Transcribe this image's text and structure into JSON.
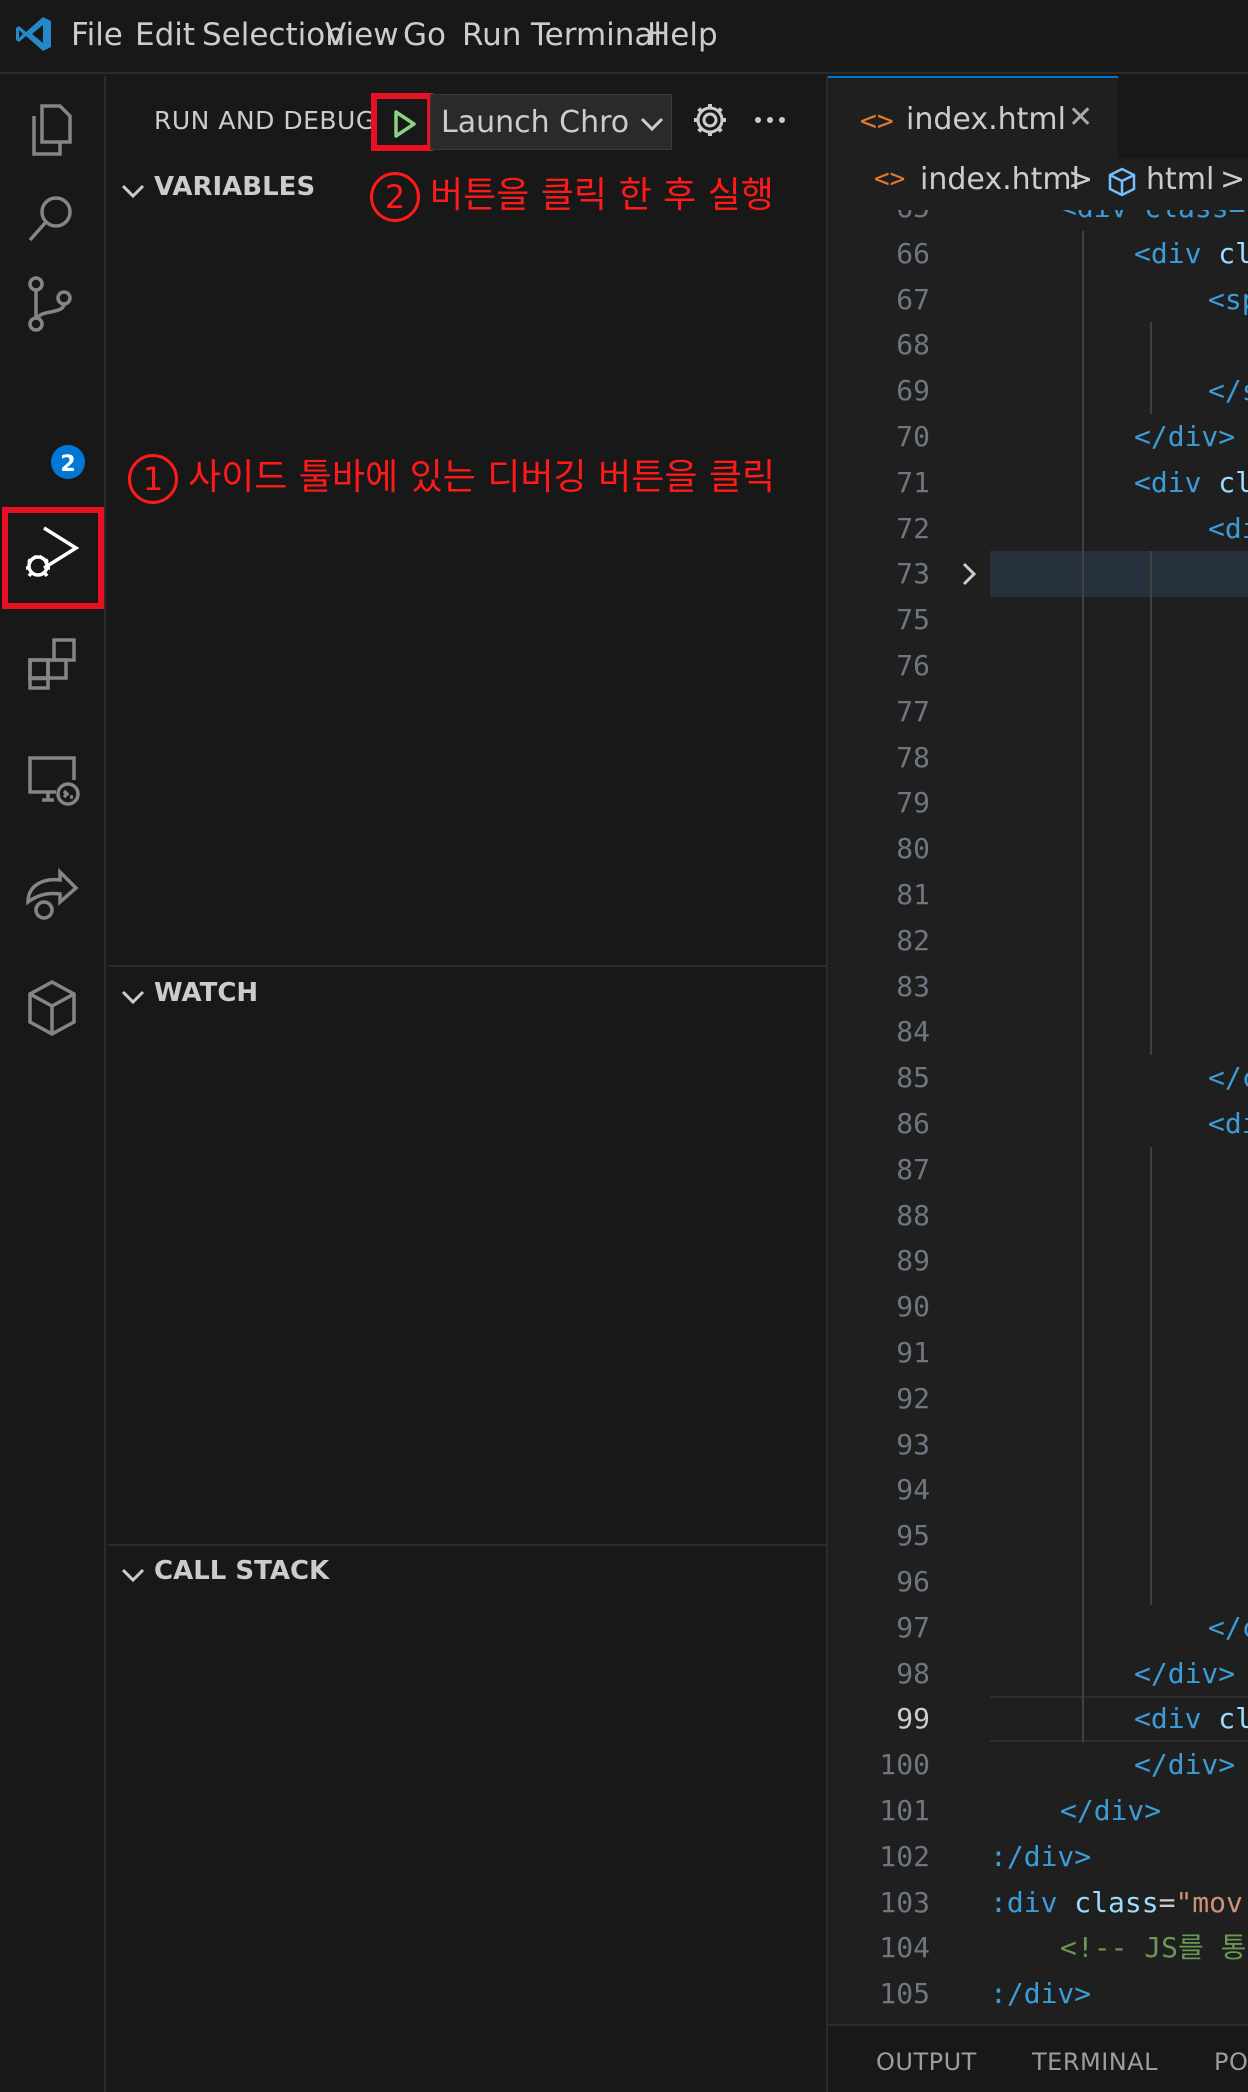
{
  "menu": [
    "File",
    "Edit",
    "Selection",
    "View",
    "Go",
    "Run",
    "Terminal",
    "Help"
  ],
  "activity_bar": {
    "items": [
      "explorer-icon",
      "search-icon",
      "source-control-icon",
      "run-and-debug-icon",
      "extensions-icon",
      "remote-explorer-icon",
      "live-share-icon",
      "codesandbox-icon"
    ],
    "source_control_badge": "2"
  },
  "sidebar": {
    "title": "RUN AND DEBUG",
    "launch_config": "Launch Chro",
    "sections": {
      "variables": "VARIABLES",
      "watch": "WATCH",
      "call_stack": "CALL STACK"
    }
  },
  "annotations": {
    "first": {
      "num": "1",
      "text": "사이드 툴바에 있는 디버깅 버튼을 클릭"
    },
    "second": {
      "num": "2",
      "text": "버튼을 클릭 한 후 실행"
    }
  },
  "editor": {
    "tab_label": "index.html",
    "tab_icon": "<>",
    "breadcrumb": {
      "file": "index.html",
      "element": "html",
      "sep": ">"
    },
    "active_line": "99",
    "lines": [
      {
        "n": "65",
        "t": [
          [
            "tag",
            "<div class="
          ]
        ]
      },
      {
        "n": "66",
        "t": [
          [
            "tag",
            "<div "
          ],
          [
            "attr",
            "cl"
          ]
        ]
      },
      {
        "n": "67",
        "t": [
          [
            "tag",
            "<sp"
          ]
        ]
      },
      {
        "n": "68",
        "t": []
      },
      {
        "n": "69",
        "t": [
          [
            "tag",
            "</s"
          ]
        ]
      },
      {
        "n": "70",
        "t": [
          [
            "tag",
            "</div>"
          ]
        ]
      },
      {
        "n": "71",
        "t": [
          [
            "tag",
            "<div "
          ],
          [
            "attr",
            "cl"
          ]
        ]
      },
      {
        "n": "72",
        "t": [
          [
            "tag",
            "<di"
          ]
        ]
      },
      {
        "n": "73",
        "t": []
      },
      {
        "n": "75",
        "t": []
      },
      {
        "n": "76",
        "t": []
      },
      {
        "n": "77",
        "t": []
      },
      {
        "n": "78",
        "t": []
      },
      {
        "n": "79",
        "t": []
      },
      {
        "n": "80",
        "t": []
      },
      {
        "n": "81",
        "t": []
      },
      {
        "n": "82",
        "t": []
      },
      {
        "n": "83",
        "t": []
      },
      {
        "n": "84",
        "t": []
      },
      {
        "n": "85",
        "t": [
          [
            "tag",
            "</c"
          ]
        ]
      },
      {
        "n": "86",
        "t": [
          [
            "tag",
            "<di"
          ]
        ]
      },
      {
        "n": "87",
        "t": []
      },
      {
        "n": "88",
        "t": []
      },
      {
        "n": "89",
        "t": []
      },
      {
        "n": "90",
        "t": []
      },
      {
        "n": "91",
        "t": []
      },
      {
        "n": "92",
        "t": []
      },
      {
        "n": "93",
        "t": []
      },
      {
        "n": "94",
        "t": []
      },
      {
        "n": "95",
        "t": []
      },
      {
        "n": "96",
        "t": []
      },
      {
        "n": "97",
        "t": [
          [
            "tag",
            "</c"
          ]
        ]
      },
      {
        "n": "98",
        "t": [
          [
            "tag",
            "</div>"
          ]
        ]
      },
      {
        "n": "99",
        "t": [
          [
            "tag",
            "<div "
          ],
          [
            "attr",
            "cl"
          ]
        ]
      },
      {
        "n": "100",
        "t": [
          [
            "tag",
            "</div>"
          ]
        ]
      },
      {
        "n": "101",
        "t": [
          [
            "tag",
            "</div>"
          ]
        ]
      },
      {
        "n": "102",
        "t": [
          [
            "tag",
            ":/div>"
          ]
        ]
      },
      {
        "n": "103",
        "t": [
          [
            "tag",
            ":div "
          ],
          [
            "attr",
            "class"
          ],
          [
            "txt",
            "="
          ],
          [
            "str",
            "\"mov"
          ]
        ]
      },
      {
        "n": "104",
        "t": [
          [
            "cm",
            "<!-- JS를 통"
          ]
        ]
      },
      {
        "n": "105",
        "t": [
          [
            "tag",
            ":/div>"
          ]
        ]
      }
    ]
  },
  "panel_tabs": [
    "OUTPUT",
    "TERMINAL",
    "PO"
  ],
  "colors": {
    "accent": "#0078d4",
    "annotation_red": "#e81123",
    "play_green": "#89d185"
  }
}
